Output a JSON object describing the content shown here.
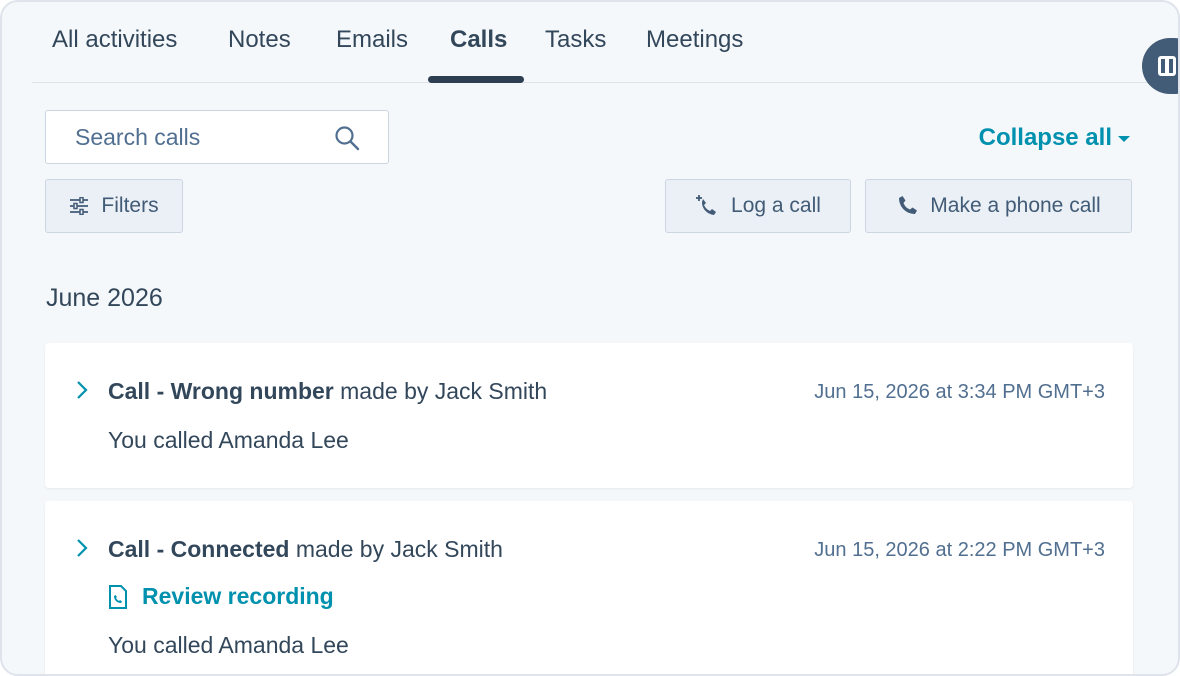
{
  "tabs": [
    {
      "label": "All activities"
    },
    {
      "label": "Notes"
    },
    {
      "label": "Emails"
    },
    {
      "label": "Calls",
      "active": true
    },
    {
      "label": "Tasks"
    },
    {
      "label": "Meetings"
    }
  ],
  "search": {
    "placeholder": "Search calls",
    "value": ""
  },
  "collapse_all_label": "Collapse all",
  "buttons": {
    "filters": "Filters",
    "log_call": "Log a call",
    "make_call": "Make a phone call"
  },
  "month_heading": "June 2026",
  "calls": [
    {
      "title_bold": "Call - Wrong number",
      "title_rest": " made by Jack Smith",
      "date": "Jun 15, 2026 at 3:34 PM GMT+3",
      "description": "You called Amanda Lee"
    },
    {
      "title_bold": "Call - Connected",
      "title_rest": " made by Jack Smith",
      "date": "Jun 15, 2026 at 2:22 PM GMT+3",
      "recording_label": "Review recording",
      "description": "You called Amanda Lee"
    }
  ],
  "colors": {
    "accent": "#0091ae",
    "text": "#33475b",
    "tab_indicator": "#2d3e50",
    "background": "#f5f8fa"
  },
  "icons": [
    "search-icon",
    "filters-icon",
    "phone-plus-icon",
    "phone-icon",
    "chevron-right-icon",
    "recording-file-icon",
    "panel-toggle-icon"
  ]
}
